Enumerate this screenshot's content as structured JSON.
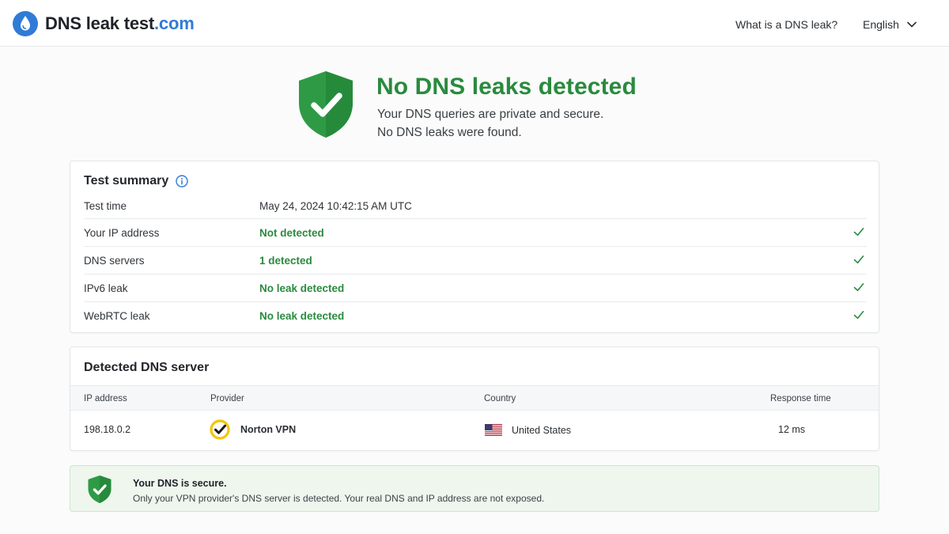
{
  "header": {
    "logo_text": "DNS leak test",
    "logo_suffix": ".com",
    "nav_link": "What is a DNS leak?",
    "language": "English"
  },
  "hero": {
    "title": "No DNS leaks detected",
    "subtitle_line1": "Your DNS queries are private and secure.",
    "subtitle_line2": "No DNS leaks were found."
  },
  "summary": {
    "title": "Test summary",
    "rows": [
      {
        "label": "Test time",
        "value": "May 24, 2024 10:42:15 AM UTC"
      },
      {
        "label": "Your IP address",
        "value": "Not detected"
      },
      {
        "label": "DNS servers",
        "value": "1 detected"
      },
      {
        "label": "IPv6 leak",
        "value": "No leak detected"
      },
      {
        "label": "WebRTC leak",
        "value": "No leak detected"
      }
    ]
  },
  "dns_server": {
    "title": "Detected DNS server",
    "columns": [
      "IP address",
      "Provider",
      "Country",
      "Response time"
    ],
    "row": {
      "ip": "198.18.0.2",
      "provider": "Norton VPN",
      "country": "United States",
      "response_time": "12 ms"
    }
  },
  "banner": {
    "title": "Your DNS is secure.",
    "text": "Only your VPN provider's DNS server is detected. Your real DNS and IP address are not exposed."
  },
  "icons": {
    "logo": "water-drop-icon",
    "language": "chevron-down-icon",
    "hero": "shield-check-icon",
    "info": "info-icon",
    "status": "checkmark-icon",
    "provider": "norton-logo-icon",
    "country": "us-flag-icon",
    "banner": "shield-check-icon"
  },
  "colors": {
    "success": "#2a8a3e",
    "brand_blue": "#2f7bd7",
    "banner_bg": "#eef6ee"
  }
}
